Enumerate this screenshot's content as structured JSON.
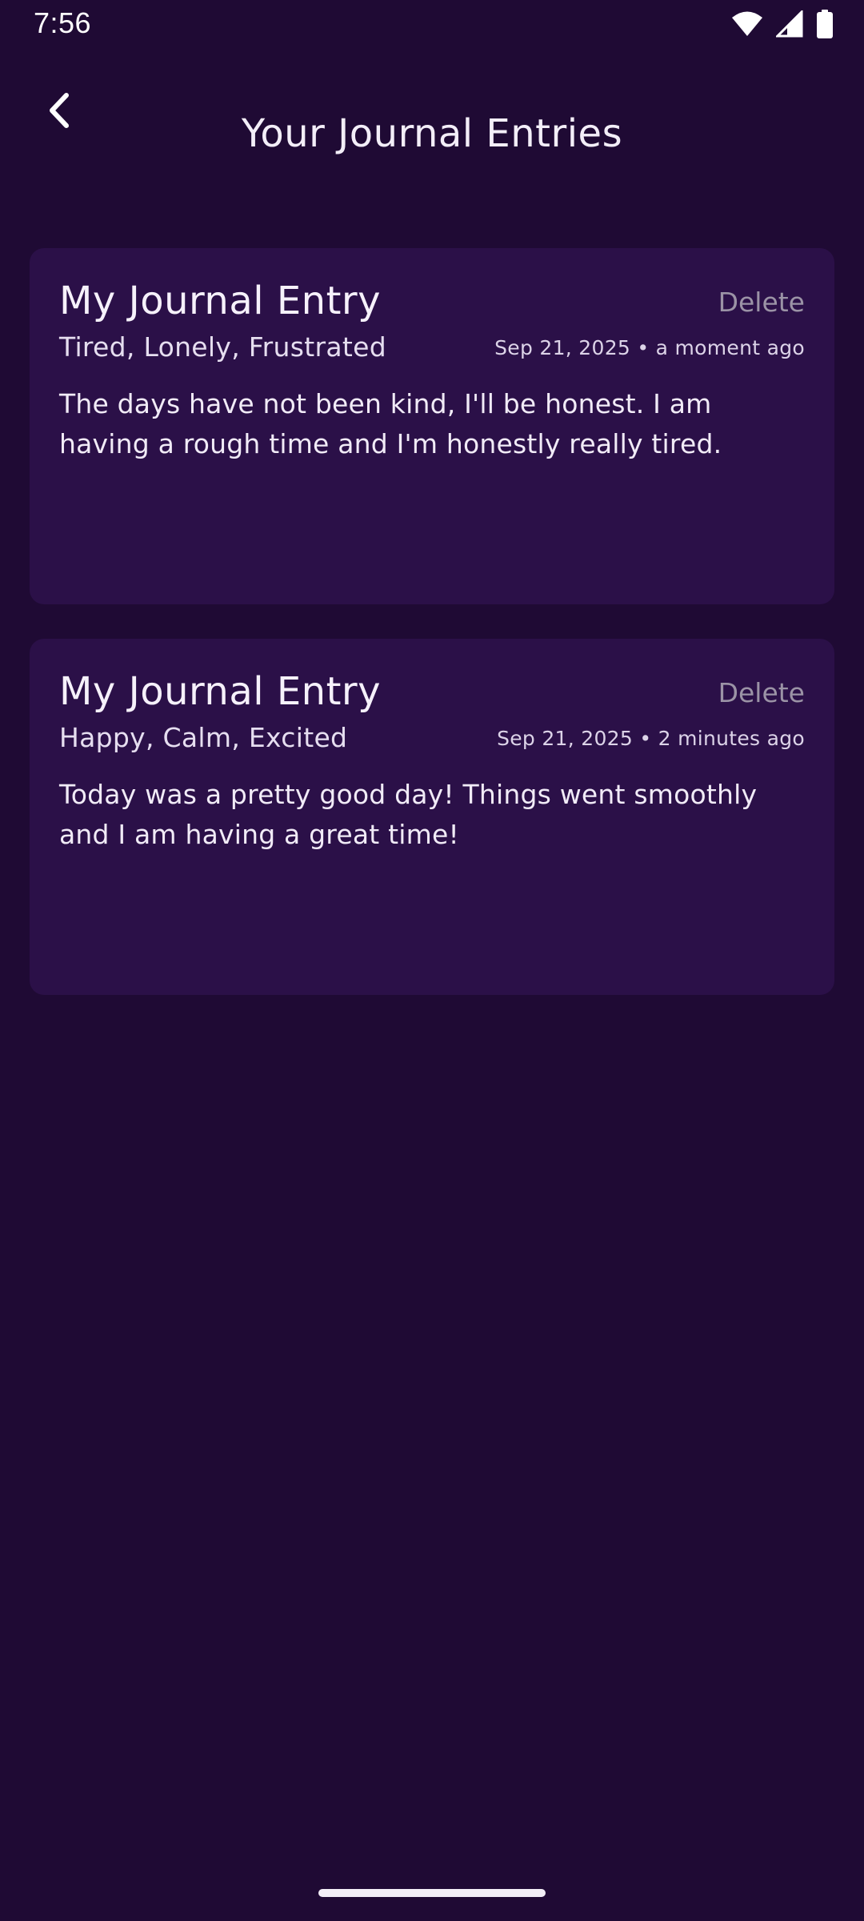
{
  "status_bar": {
    "time": "7:56",
    "icons": [
      "wifi-icon",
      "cellular-signal-icon",
      "battery-icon"
    ]
  },
  "header": {
    "back_icon": "chevron-left-icon",
    "title": "Your Journal Entries"
  },
  "entries": [
    {
      "title": "My Journal Entry",
      "delete_label": "Delete",
      "moods": "Tired, Lonely, Frustrated",
      "meta": "Sep 21, 2025 • a moment ago",
      "text": "The days have not been kind, I'll be honest. I am having a rough time and I'm honestly really tired."
    },
    {
      "title": "My Journal Entry",
      "delete_label": "Delete",
      "moods": "Happy, Calm, Excited",
      "meta": "Sep 21, 2025 • 2 minutes ago",
      "text": "Today was a pretty good day! Things went smoothly and I am having a great time!"
    }
  ],
  "colors": {
    "background": "#1f0a34",
    "card": "#2b1048",
    "delete_text": "#9b93a6"
  }
}
